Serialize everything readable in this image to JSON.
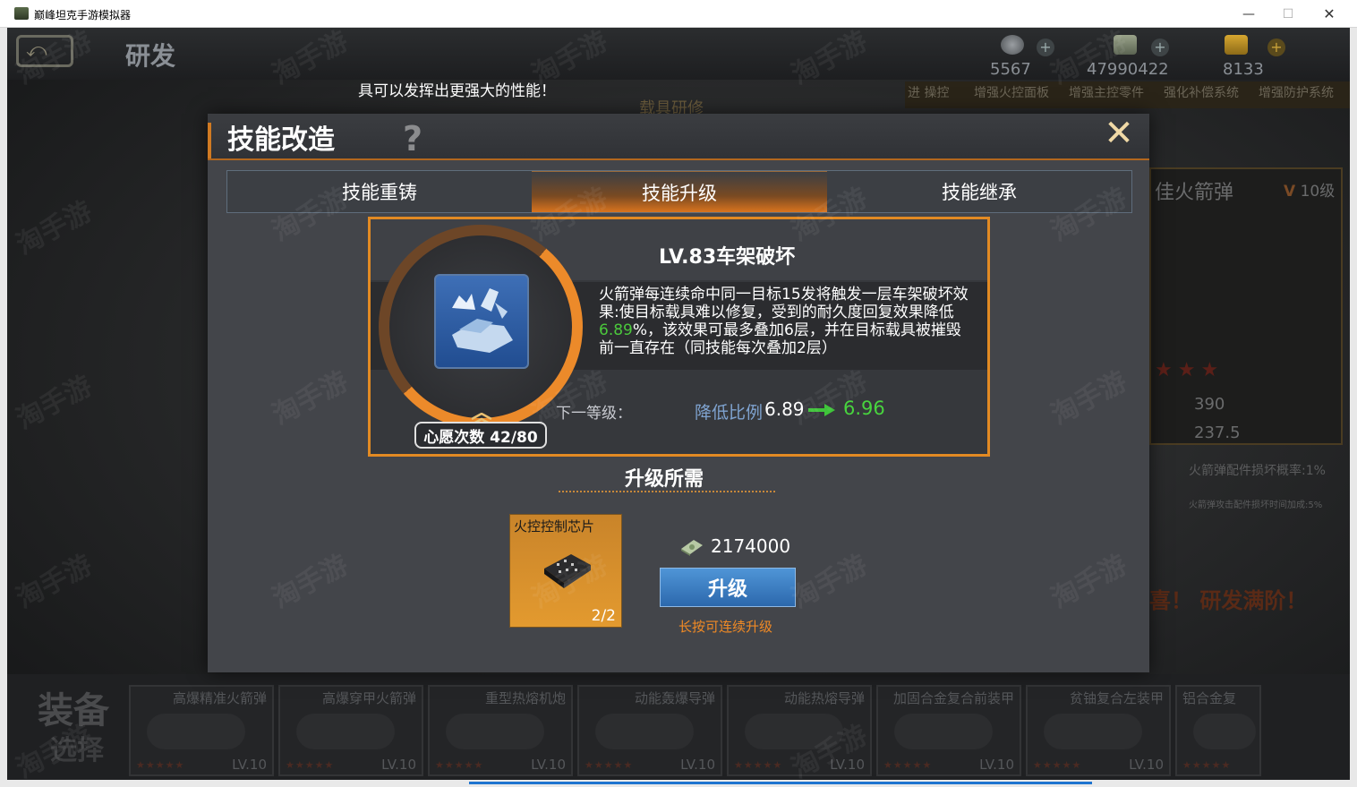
{
  "window": {
    "title": "巅峰坦克手游模拟器",
    "min": "—",
    "max": "☐",
    "close": "✕"
  },
  "hud": {
    "back": "⤺",
    "title": "研发",
    "resources": [
      {
        "icon": "medal-icon",
        "value": "5567"
      },
      {
        "icon": "cash-icon",
        "value": "47990422"
      },
      {
        "icon": "gold-icon",
        "value": "8133"
      }
    ]
  },
  "background": {
    "hint": "具可以发挥出更强大的性能！",
    "subtitle": "载具研修",
    "tabs": [
      "进 操控",
      "增强火控面板",
      "增强主控零件",
      "强化补偿系统",
      "增强防护系统"
    ],
    "card": {
      "name": "佳火箭弹",
      "level_prefix": "V",
      "level": "10级",
      "stars": "★★★",
      "stat1": "390",
      "stat2": "237.5"
    },
    "prop1": "火箭弹配件损坏概率:1%",
    "prop2": "火箭弹攻击配件损坏时间加成:5%",
    "congrats": "喜！ 研发满阶！"
  },
  "equip": {
    "title": "装备",
    "select": "选择",
    "items": [
      {
        "name": "高爆精准火箭弹",
        "lv": "LV.10"
      },
      {
        "name": "高爆穿甲火箭弹",
        "lv": "LV.10"
      },
      {
        "name": "重型热熔机炮",
        "lv": "LV.10"
      },
      {
        "name": "动能轰爆导弹",
        "lv": "LV.10"
      },
      {
        "name": "动能热熔导弹",
        "lv": "LV.10"
      },
      {
        "name": "加固合金复合前装甲",
        "lv": "LV.10"
      },
      {
        "name": "贫铀复合左装甲",
        "lv": "LV.10"
      },
      {
        "name": "铝合金复",
        "lv": ""
      }
    ],
    "stars": "★★★★★"
  },
  "dialog": {
    "title": "技能改造",
    "help": "?",
    "close": "✕",
    "tabs": [
      "技能重铸",
      "技能升级",
      "技能继承"
    ],
    "active_tab": 1,
    "skill": {
      "name": "LV.83车架破坏",
      "desc_part1": "火箭弹每连续命中同一目标15发将触发一层车架破坏效果:使目标载具难以修复，受到的耐久度回复效果降低",
      "desc_highlight": "6.89",
      "desc_part2": "%，该效果可最多叠加6层，并在目标载具被摧毁前一直存在（同技能每次叠加2层）",
      "next_label": "下一等级：",
      "stat_name": "降低比例",
      "current": "6.89",
      "next": "6.96",
      "wish_label": "心愿次数 42/80",
      "wish_progress": 0.525
    },
    "requirements": {
      "title": "升级所需",
      "material_name": "火控控制芯片",
      "material_count": "2/2",
      "money": "2174000",
      "upgrade_label": "升级",
      "hold_hint": "长按可连续升级"
    }
  },
  "watermark": "淘手游",
  "colors": {
    "accent": "#e28a23",
    "highlight_green": "#48d43e",
    "button_blue": "#3a7cc1"
  }
}
